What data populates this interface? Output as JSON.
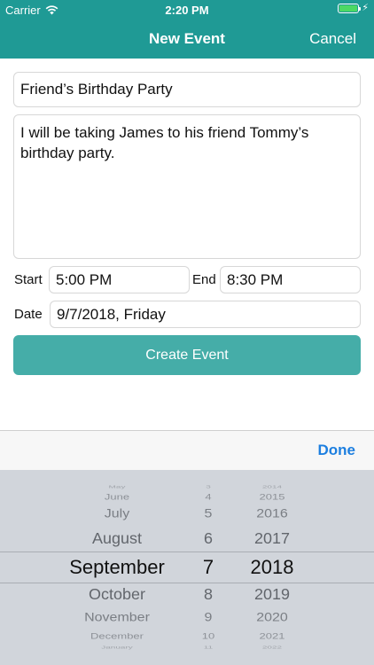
{
  "status_bar": {
    "carrier": "Carrier",
    "time": "2:20 PM"
  },
  "nav": {
    "title": "New Event",
    "cancel_label": "Cancel"
  },
  "form": {
    "title_value": "Friend’s Birthday Party",
    "description_value": "I will be taking James to his friend Tommy’s birthday party.",
    "start_label": "Start",
    "start_value": "5:00 PM",
    "end_label": "End",
    "end_value": "8:30 PM",
    "date_label": "Date",
    "date_value": "9/7/2018, Friday",
    "create_button_label": "Create Event"
  },
  "picker": {
    "done_label": "Done",
    "months": [
      "May",
      "June",
      "July",
      "August",
      "September",
      "October",
      "November",
      "December",
      "January"
    ],
    "days": [
      "3",
      "4",
      "5",
      "6",
      "7",
      "8",
      "9",
      "10",
      "11"
    ],
    "years": [
      "2014",
      "2015",
      "2016",
      "2017",
      "2018",
      "2019",
      "2020",
      "2021",
      "2022"
    ],
    "selected_month": "September",
    "selected_day": "7",
    "selected_year": "2018"
  },
  "colors": {
    "header": "#1f9a95",
    "button": "#45ada8",
    "done": "#1d7fe0",
    "picker_bg": "#d1d5db"
  }
}
